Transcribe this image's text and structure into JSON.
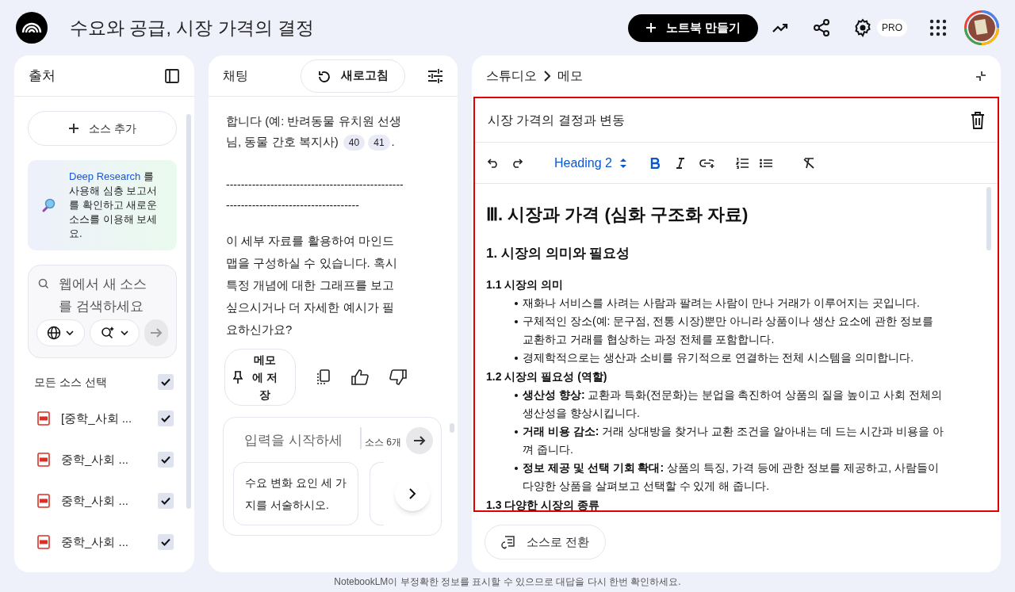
{
  "header": {
    "title": "수요와 공급, 시장 가격의 결정",
    "create_button": "노트북 만들기",
    "plan_badge": "PRO"
  },
  "sources": {
    "title": "출처",
    "add_button": "소스 추가",
    "deep_research": {
      "link": "Deep Research",
      "text": " 를 사용해 심층 보고서를 확인하고 새로운 소스를 이용해 보세요."
    },
    "web_search": {
      "placeholder": "웹에서 새 소스를 검색하세요"
    },
    "select_all": {
      "label": "모든 소스 선택",
      "checked": true
    },
    "items": [
      {
        "name": "[중학_사회 ...",
        "checked": true
      },
      {
        "name": "중학_사회 ...",
        "checked": true
      },
      {
        "name": "중학_사회 ...",
        "checked": true
      },
      {
        "name": "중학_사회 ...",
        "checked": true
      }
    ]
  },
  "chat": {
    "title": "채팅",
    "refresh_button": "새로고침",
    "message": {
      "lead": "합니다 (예: 반려동물 유치원 선생님, 동물 간호 복지사)",
      "citations": [
        "40",
        "41"
      ],
      "lead_end": ".",
      "divider": "------------------------------------------------------------------------------------",
      "closing": "이 세부 자료를 활용하여 마인드맵을 구성하실 수 있습니다. 혹시 특정 개념에 대한 그래프를 보고 싶으시거나 더 자세한 예시가 필요하신가요?"
    },
    "save_button": "메모에 저장",
    "input": {
      "placeholder": "입력을 시작하세",
      "source_count": "소스 6개"
    },
    "suggestions": [
      "수요 변화 요인 세 가지를 서술하시오."
    ]
  },
  "studio": {
    "breadcrumb": [
      "스튜디오",
      "메모"
    ],
    "note_title": "시장 가격의 결정과 변동",
    "block_style": "Heading 2",
    "content": [
      {
        "kind": "h1",
        "text": "Ⅲ. 시장과 가격 (심화 구조화 자료)"
      },
      {
        "kind": "h2",
        "text": "1. 시장의 의미와 필요성"
      },
      {
        "kind": "h3",
        "text": "1.1 시장의 의미"
      },
      {
        "kind": "bullet",
        "text": "재화나 서비스를 사려는 사람과 팔려는 사람이 만나 거래가 이루어지는 곳입니다."
      },
      {
        "kind": "bullet",
        "text": "구체적인 장소(예: 문구점, 전통 시장)뿐만 아니라 상품이나 생산 요소에 관한 정보를 교환하고 거래를 협상하는 과정 전체를 포함합니다."
      },
      {
        "kind": "bullet",
        "text": "경제학적으로는 생산과 소비를 유기적으로 연결하는 전체 시스템을 의미합니다."
      },
      {
        "kind": "h3",
        "text": "1.2 시장의 필요성 (역할)"
      },
      {
        "kind": "bullet",
        "text": "**생산성 향상:** 교환과 특화(전문화)는 분업을 촉진하여 상품의 질을 높이고 사회 전체의 생산성을 향상시킵니다."
      },
      {
        "kind": "bullet",
        "text": "**거래 비용 감소:** 거래 상대방을 찾거나 교환 조건을 알아내는 데 드는 시간과 비용을 아껴 줍니다."
      },
      {
        "kind": "bullet",
        "text": "**정보 제공 및 선택 기회 확대:** 상품의 특징, 가격 등에 관한 정보를 제공하고, 사람들이 다양한 상품을 살펴보고 선택할 수 있게 해 줍니다."
      },
      {
        "kind": "h3",
        "text": "1.3 다양한 시장의 종류"
      }
    ],
    "convert_button": "소스로 전환"
  },
  "footer": "NotebookLM이 부정확한 정보를 표시할 수 있으므로 대답을 다시 한번 확인하세요."
}
